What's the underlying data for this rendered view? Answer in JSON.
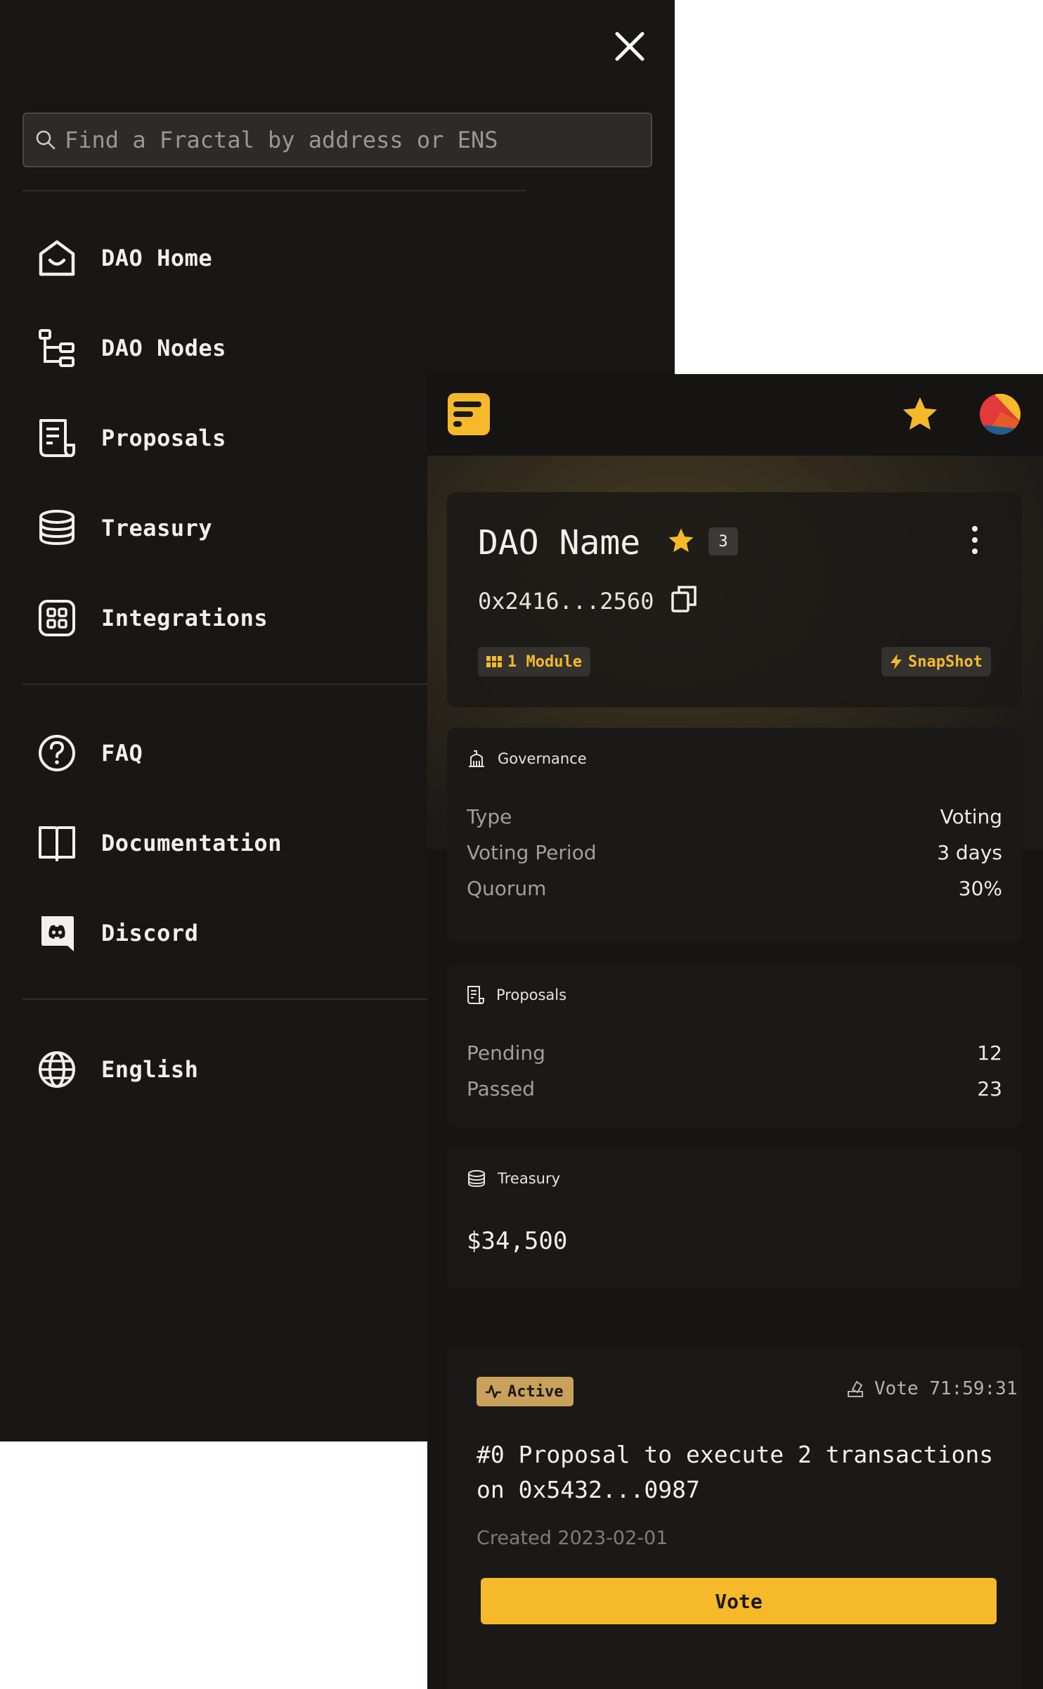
{
  "search": {
    "placeholder": "Find a Fractal by address or ENS"
  },
  "nav": {
    "items": [
      {
        "label": "DAO Home",
        "icon": "dao-home-icon"
      },
      {
        "label": "DAO Nodes",
        "icon": "dao-nodes-icon"
      },
      {
        "label": "Proposals",
        "icon": "proposals-icon"
      },
      {
        "label": "Treasury",
        "icon": "treasury-icon"
      },
      {
        "label": "Integrations",
        "icon": "integrations-icon"
      }
    ],
    "support": [
      {
        "label": "FAQ",
        "icon": "faq-icon"
      },
      {
        "label": "Documentation",
        "icon": "documentation-icon"
      },
      {
        "label": "Discord",
        "icon": "discord-icon"
      }
    ],
    "language": {
      "label": "English",
      "icon": "globe-icon"
    }
  },
  "dao": {
    "name": "DAO Name",
    "favorite_count": "3",
    "address": "0x2416...2560",
    "modules_label": "1 Module",
    "snapshot_label": "SnapShot"
  },
  "governance": {
    "heading": "Governance",
    "rows": [
      {
        "label": "Type",
        "value": "Voting"
      },
      {
        "label": "Voting Period",
        "value": "3 days"
      },
      {
        "label": "Quorum",
        "value": "30%"
      }
    ]
  },
  "proposals_summary": {
    "heading": "Proposals",
    "rows": [
      {
        "label": "Pending",
        "value": "12"
      },
      {
        "label": "Passed",
        "value": "23"
      }
    ]
  },
  "treasury": {
    "heading": "Treasury",
    "value": "$34,500"
  },
  "proposal": {
    "status": "Active",
    "vote_timer": "Vote 71:59:31",
    "title": "#0 Proposal to execute 2 transactions on 0x5432...0987",
    "created": "Created 2023-02-01",
    "vote_label": "Vote"
  },
  "colors": {
    "accent": "#f6b92a",
    "background": "#181716",
    "active_badge": "#c9a15a"
  }
}
